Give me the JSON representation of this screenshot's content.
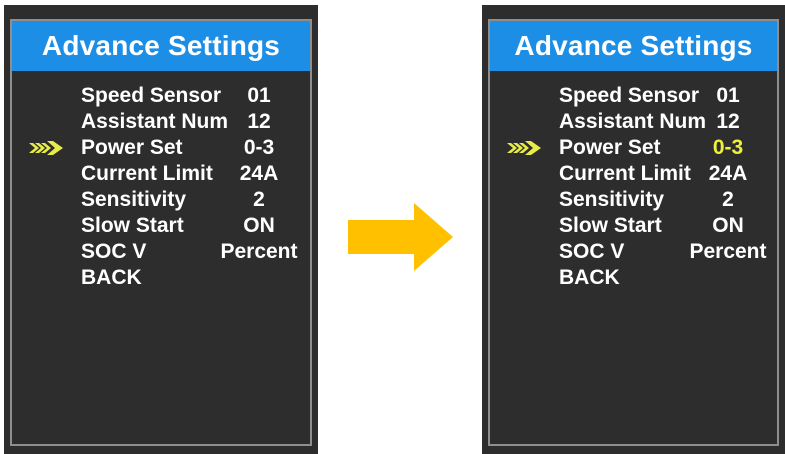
{
  "screens": [
    {
      "title": "Advance Settings",
      "items": [
        {
          "label": "Speed Sensor",
          "value": "01"
        },
        {
          "label": "Assistant Num",
          "value": "12"
        },
        {
          "label": "Power Set",
          "value": "0-3"
        },
        {
          "label": "Current Limit",
          "value": "24A"
        },
        {
          "label": "Sensitivity",
          "value": "2"
        },
        {
          "label": "Slow Start",
          "value": "ON"
        },
        {
          "label": "SOC V",
          "value": "Percent"
        },
        {
          "label": "BACK",
          "value": ""
        }
      ],
      "selected_index": 2,
      "value_highlighted": false
    },
    {
      "title": "Advance Settings",
      "items": [
        {
          "label": "Speed Sensor",
          "value": "01"
        },
        {
          "label": "Assistant Num",
          "value": "12"
        },
        {
          "label": "Power Set",
          "value": "0-3"
        },
        {
          "label": "Current Limit",
          "value": "24A"
        },
        {
          "label": "Sensitivity",
          "value": "2"
        },
        {
          "label": "Slow Start",
          "value": "ON"
        },
        {
          "label": "SOC V",
          "value": "Percent"
        },
        {
          "label": "BACK",
          "value": ""
        }
      ],
      "selected_index": 2,
      "value_highlighted": true
    }
  ],
  "transition_icon": "right-arrow-icon",
  "colors": {
    "title_bar": "#1c8ee6",
    "screen_bg": "#2d2d2d",
    "pointer": "#e8ec4a",
    "highlight_value": "#eef03a",
    "transition_arrow": "#ffc000"
  }
}
